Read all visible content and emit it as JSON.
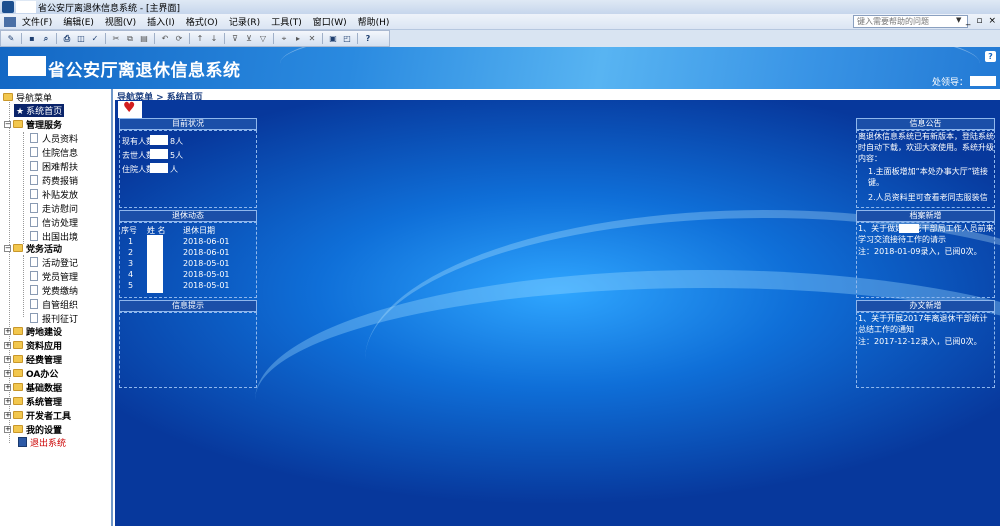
{
  "window": {
    "title": "省公安厅离退休信息系统 - [主界面]",
    "help_placeholder": "键入需要帮助的问题",
    "controls": [
      "_",
      "▫",
      "×"
    ]
  },
  "menu": [
    "文件(F)",
    "编辑(E)",
    "视图(V)",
    "插入(I)",
    "格式(O)",
    "记录(R)",
    "工具(T)",
    "窗口(W)",
    "帮助(H)"
  ],
  "header": {
    "title": "省公安厅离退休信息系统",
    "help": "?",
    "user_label": "处领导："
  },
  "breadcrumb": "导航菜单 > 系统首页",
  "sidebar": {
    "root": "导航菜单",
    "home": "系统首页",
    "groups": [
      {
        "label": "管理服务",
        "items": [
          "人员资料",
          "住院信息",
          "困难帮扶",
          "药费报销",
          "补贴发放",
          "走访慰问",
          "信访处理",
          "出国出境"
        ]
      },
      {
        "label": "党务活动",
        "items": [
          "活动登记",
          "党员管理",
          "党费缴纳",
          "自管组织",
          "报刊征订"
        ]
      }
    ],
    "collapsed": [
      "跨地建设",
      "资料应用",
      "经费管理",
      "OA办公",
      "基础数据",
      "系统管理",
      "开发者工具",
      "我的设置"
    ],
    "exit": "退出系统"
  },
  "panels": {
    "current_status": {
      "title": "目前状况",
      "lines": [
        "现有人数：",
        "去世人数：",
        "住院人数："
      ],
      "values": [
        "8人",
        "5人",
        "人"
      ]
    },
    "retire_news": {
      "title": "退休动态",
      "headers": [
        "序号",
        "姓  名",
        "退休日期"
      ],
      "rows": [
        {
          "no": "1",
          "date": "2018-06-01"
        },
        {
          "no": "2",
          "date": "2018-06-01"
        },
        {
          "no": "3",
          "date": "2018-05-01"
        },
        {
          "no": "4",
          "date": "2018-05-01"
        },
        {
          "no": "5",
          "date": "2018-05-01"
        }
      ]
    },
    "info_tips": {
      "title": "信息提示"
    },
    "announcement": {
      "title": "信息公告",
      "text": "离退休信息系统已有新版本，登陆系统时自动下载，欢迎大家使用。系统升级内容：",
      "item1": "1.主面板增加“本处办事大厅”链接键。",
      "item2": "2.人员资料里可查看老同志服装信"
    },
    "archive": {
      "title": "档案新增",
      "text": "1、关于做好    的老干部局工作人员前来学习交流接待工作的请示",
      "note": "注：2018-01-09录入，已阅0次。"
    },
    "office": {
      "title": "办文新增",
      "text": "1、关于开展2017年离退休干部统计总结工作的通知",
      "note": "注：2017-12-12录入，已阅0次。"
    }
  }
}
